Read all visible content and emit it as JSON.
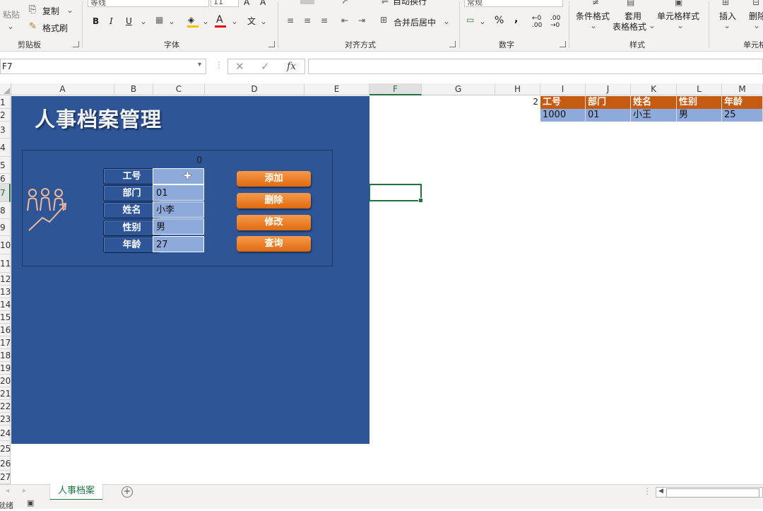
{
  "ribbon": {
    "clipboard": {
      "paste": "粘贴",
      "copy": "复制",
      "format_painter": "格式刷",
      "group": "剪贴板"
    },
    "font": {
      "font_name": "等线",
      "font_size": "11",
      "group": "字体"
    },
    "alignment": {
      "wrap_text": "自动换行",
      "merge_center": "合并后居中",
      "group": "对齐方式"
    },
    "number": {
      "format": "常规",
      "group": "数字"
    },
    "styles": {
      "conditional": "条件格式",
      "table_format_1": "套用",
      "table_format_2": "表格格式",
      "cell_styles": "单元格样式",
      "group": "样式"
    },
    "cells": {
      "insert": "插入",
      "delete": "删除",
      "group": "单元格"
    }
  },
  "formula_bar": {
    "name_box": "F7",
    "fx": "fx",
    "value": ""
  },
  "columns": [
    "A",
    "B",
    "C",
    "D",
    "E",
    "F",
    "G",
    "H",
    "I",
    "J",
    "K",
    "L",
    "M"
  ],
  "rows": [
    "1",
    "2",
    "3",
    "4",
    "5",
    "6",
    "7",
    "8",
    "9",
    "10",
    "11",
    "12",
    "13",
    "14",
    "15",
    "16",
    "17",
    "18",
    "19",
    "20",
    "21",
    "22",
    "23",
    "24",
    "25",
    "26",
    "27"
  ],
  "panel": {
    "title": "人事档案管理",
    "counter": "0",
    "fields": [
      {
        "label": "工号",
        "value": ""
      },
      {
        "label": "部门",
        "value": "01"
      },
      {
        "label": "姓名",
        "value": "小李"
      },
      {
        "label": "性别",
        "value": "男"
      },
      {
        "label": "年龄",
        "value": "27"
      }
    ],
    "buttons": [
      "添加",
      "删除",
      "修改",
      "查询"
    ]
  },
  "side_table": {
    "h_value": "2",
    "headers": [
      "工号",
      "部门",
      "姓名",
      "性别",
      "年龄"
    ],
    "row": [
      "1000",
      "01",
      "小王",
      "男",
      "25"
    ]
  },
  "sheet_tab": "人事档案",
  "status": {
    "ready": "就绪"
  },
  "colors": {
    "panel": "#2e5596",
    "header": "#c55a11",
    "input": "#8eaadb",
    "button": "#ed7d31"
  }
}
